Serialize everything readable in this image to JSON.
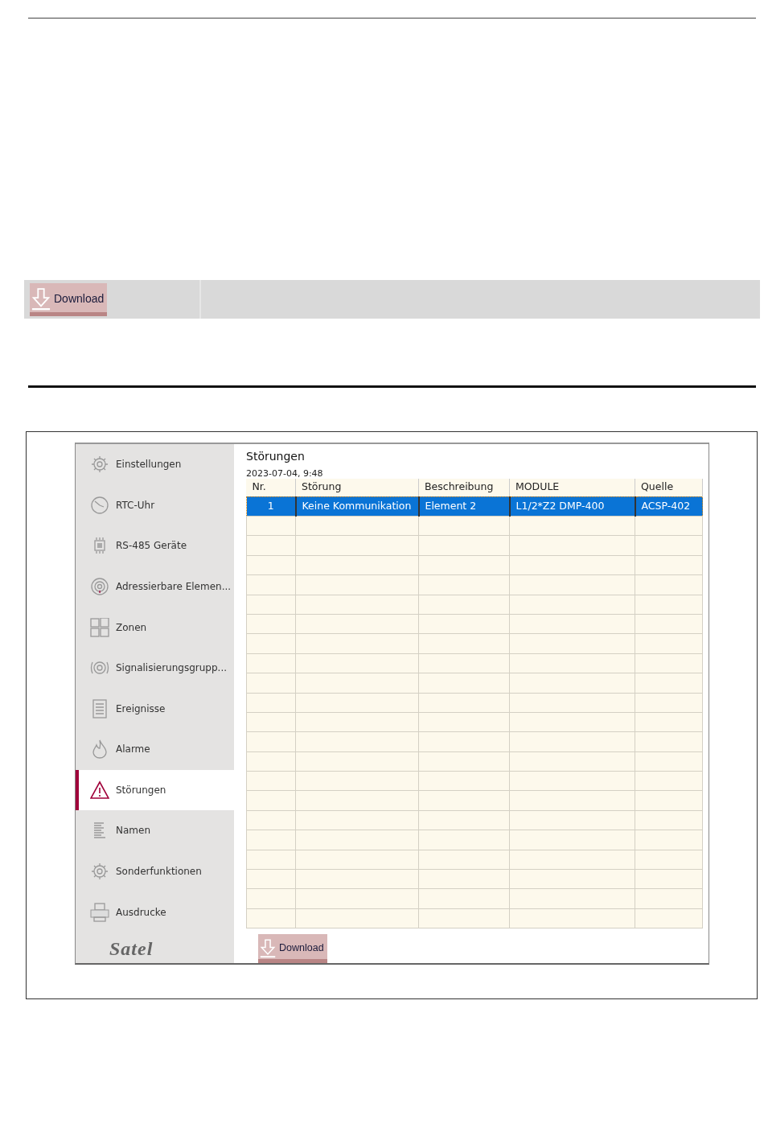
{
  "document": {
    "toolbar": {
      "download_button": "Download"
    }
  },
  "figure": {
    "sidebar": {
      "items": [
        {
          "label": "Einstellungen",
          "selected": false
        },
        {
          "label": "RTC-Uhr",
          "selected": false
        },
        {
          "label": "RS-485 Geräte",
          "selected": false
        },
        {
          "label": "Adressierbare Elemen...",
          "selected": false
        },
        {
          "label": "Zonen",
          "selected": false
        },
        {
          "label": "Signalisierungsgrupp...",
          "selected": false
        },
        {
          "label": "Ereignisse",
          "selected": false
        },
        {
          "label": "Alarme",
          "selected": false
        },
        {
          "label": "Störungen",
          "selected": true
        },
        {
          "label": "Namen",
          "selected": false
        },
        {
          "label": "Sonderfunktionen",
          "selected": false
        },
        {
          "label": "Ausdrucke",
          "selected": false
        }
      ],
      "logo": "Satel"
    },
    "panel": {
      "title": "Störungen",
      "timestamp": "2023-07-04, 9:48",
      "table": {
        "columns": [
          "Nr.",
          "Störung",
          "Beschreibung",
          "MODULE",
          "Quelle"
        ],
        "rows": [
          {
            "cells": [
              "1",
              "Keine Kommunikation",
              "Element 2",
              "L1/2*Z2 DMP-400",
              "ACSP-402"
            ],
            "selected": true
          }
        ]
      },
      "download_button": "Download"
    }
  }
}
